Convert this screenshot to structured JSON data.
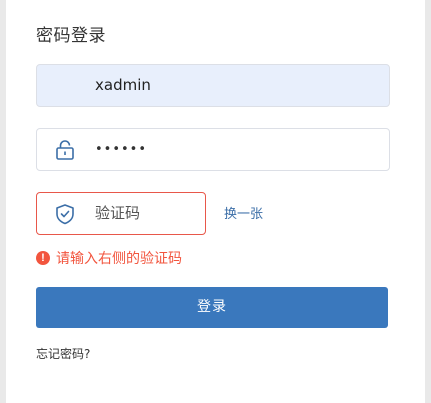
{
  "login": {
    "title": "密码登录",
    "username": {
      "value": "xadmin"
    },
    "password": {
      "value": "••••••",
      "icon": "lock-icon"
    },
    "captcha": {
      "placeholder": "验证码",
      "icon": "shield-check-icon",
      "refresh_label": "换一张"
    },
    "error": {
      "icon": "error-circle-icon",
      "message": "请输入右侧的验证码",
      "color": "#f2553e"
    },
    "submit_label": "登录",
    "forgot_label": "忘记密码?",
    "accent_color": "#3a78bd"
  }
}
